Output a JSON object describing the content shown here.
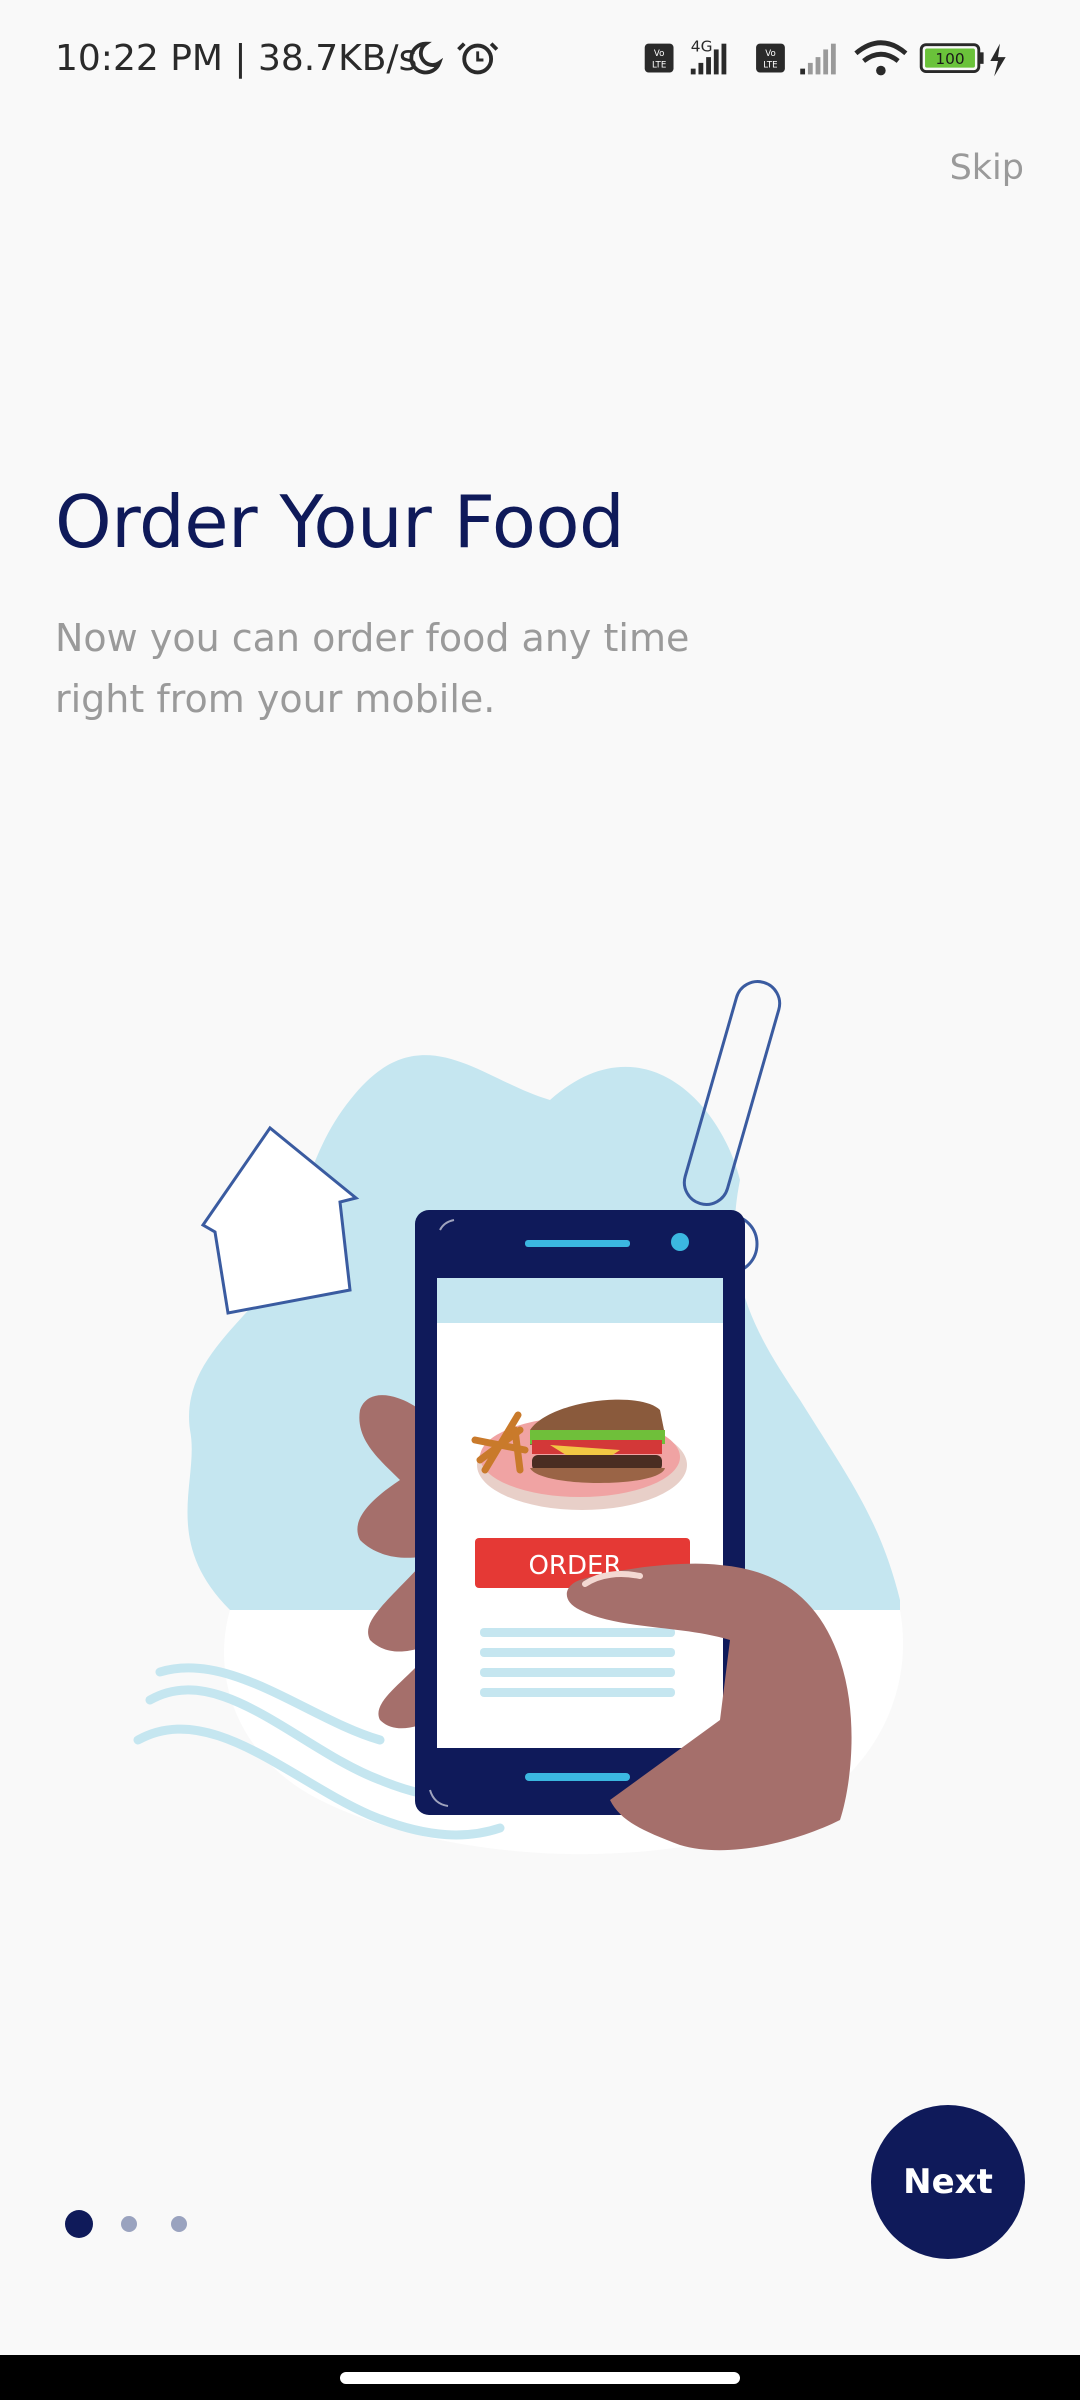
{
  "status_bar": {
    "time": "10:22 PM | 38.7KB/s",
    "network": "4G",
    "battery": "100",
    "icons": [
      "moon-icon",
      "alarm-icon",
      "volte-icon",
      "signal-icon",
      "wifi-icon",
      "battery-icon",
      "charging-icon"
    ]
  },
  "onboarding": {
    "skip_label": "Skip",
    "title": "Order Your Food",
    "subtitle": "Now you can order food any time right from your mobile.",
    "order_label": "ORDER",
    "next_label": "Next",
    "page_index": 1,
    "page_count": 3
  },
  "colors": {
    "primary": "#0f1a5a",
    "blob": "#c5e6f0",
    "order_button": "#e53935",
    "skin": "#a56f6b",
    "text_muted": "#9a9a9a"
  }
}
